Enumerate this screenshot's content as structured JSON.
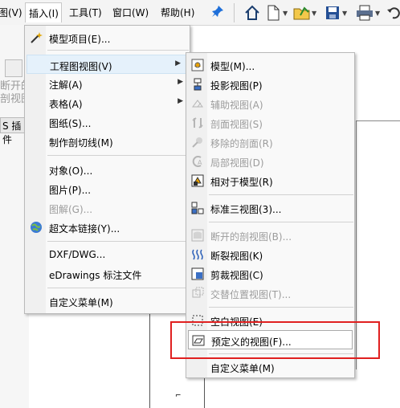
{
  "menubar": {
    "items": [
      {
        "label": "图(V)"
      },
      {
        "label": "插入(I)"
      },
      {
        "label": "工具(T)"
      },
      {
        "label": "窗口(W)"
      },
      {
        "label": "帮助(H)"
      }
    ]
  },
  "background": {
    "panel_line1": "断开的",
    "panel_line2": "剖视图",
    "tab_label": "S 插件"
  },
  "insert_menu": {
    "items": [
      {
        "label": "模型项目(E)..."
      },
      {
        "label": "工程图视图(V)"
      },
      {
        "label": "注解(A)"
      },
      {
        "label": "表格(A)"
      },
      {
        "label": "图纸(S)..."
      },
      {
        "label": "制作剖切线(M)"
      },
      {
        "label": "对象(O)..."
      },
      {
        "label": "图片(P)..."
      },
      {
        "label": "图解(G)..."
      },
      {
        "label": "超文本链接(Y)..."
      },
      {
        "label": "DXF/DWG..."
      },
      {
        "label": "eDrawings 标注文件"
      },
      {
        "label": "自定义菜单(M)"
      }
    ]
  },
  "view_menu": {
    "items": [
      {
        "label": "模型(M)..."
      },
      {
        "label": "投影视图(P)"
      },
      {
        "label": "辅助视图(A)"
      },
      {
        "label": "剖面视图(S)"
      },
      {
        "label": "移除的剖面(R)"
      },
      {
        "label": "局部视图(D)"
      },
      {
        "label": "相对于模型(R)"
      },
      {
        "label": "标准三视图(3)..."
      },
      {
        "label": "断开的剖视图(B)..."
      },
      {
        "label": "断裂视图(K)"
      },
      {
        "label": "剪裁视图(C)"
      },
      {
        "label": "交替位置视图(T)..."
      },
      {
        "label": "空白视图(E)"
      },
      {
        "label": "预定义的视图(F)..."
      },
      {
        "label": "自定义菜单(M)"
      }
    ]
  },
  "colors": {
    "highlight_box": "#e02020",
    "pin": "#1e6fd9"
  }
}
